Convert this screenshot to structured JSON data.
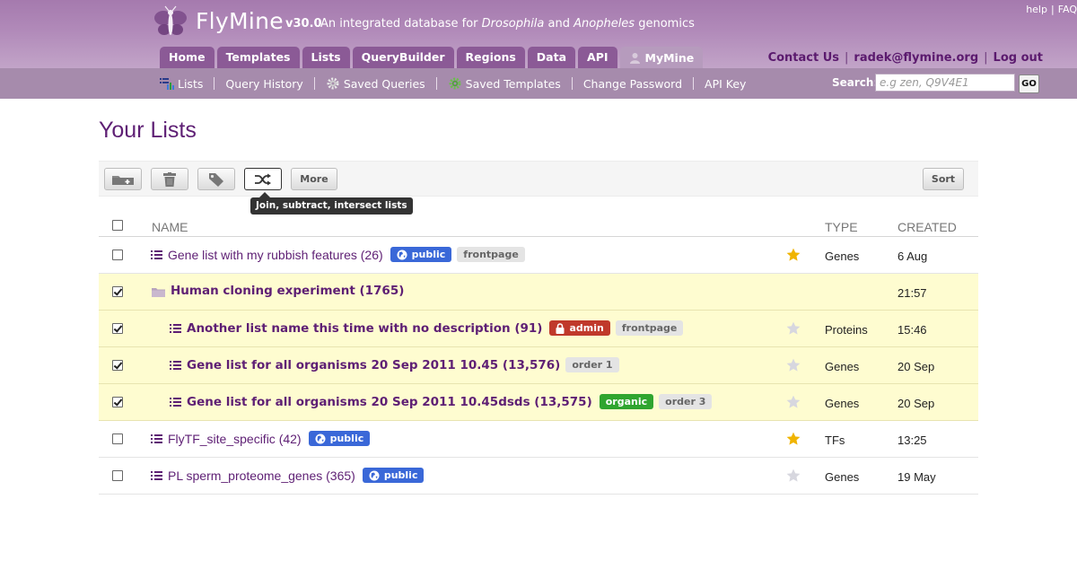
{
  "header": {
    "brand": "FlyMine",
    "version": "v30.0",
    "tagline_parts": [
      "An integrated database for ",
      "Drosophila",
      " and ",
      "Anopheles",
      " genomics"
    ],
    "top_links": [
      "help",
      "FAQ"
    ]
  },
  "tabs": [
    "Home",
    "Templates",
    "Lists",
    "QueryBuilder",
    "Regions",
    "Data",
    "API",
    "MyMine"
  ],
  "active_tab": "MyMine",
  "user_links": {
    "contact": "Contact Us",
    "email": "radek@flymine.org",
    "logout": "Log out"
  },
  "subnav": [
    "Lists",
    "Query History",
    "Saved Queries",
    "Saved Templates",
    "Change Password",
    "API Key"
  ],
  "search": {
    "label": "Search:",
    "placeholder": "e.g zen, Q9V4E1",
    "button": "GO"
  },
  "page_title": "Your Lists",
  "toolbar": {
    "more_label": "More",
    "sort_label": "Sort",
    "tooltip": "Join, subtract, intersect lists",
    "icons": [
      "add-folder-icon",
      "trash-icon",
      "tag-icon",
      "shuffle-icon"
    ]
  },
  "table": {
    "headers": {
      "name": "NAME",
      "type": "TYPE",
      "created": "CREATED"
    },
    "rows": [
      {
        "name": "Gene list with my rubbish features (26)",
        "indent": false,
        "folder": false,
        "checked": false,
        "starred": true,
        "type": "Genes",
        "created": "6 Aug",
        "badges": [
          {
            "kind": "public",
            "text": "public"
          },
          {
            "kind": "tag",
            "text": "frontpage"
          }
        ]
      },
      {
        "name": "Human cloning experiment (1765)",
        "indent": false,
        "folder": true,
        "checked": true,
        "starred": null,
        "type": "",
        "created": "21:57",
        "badges": []
      },
      {
        "name": "Another list name this time with no description (91)",
        "indent": true,
        "folder": false,
        "checked": true,
        "starred": false,
        "type": "Proteins",
        "created": "15:46",
        "badges": [
          {
            "kind": "admin",
            "text": "admin"
          },
          {
            "kind": "tag",
            "text": "frontpage"
          }
        ]
      },
      {
        "name": "Gene list for all organisms 20 Sep 2011 10.45 (13,576)",
        "indent": true,
        "folder": false,
        "checked": true,
        "starred": false,
        "type": "Genes",
        "created": "20 Sep",
        "badges": [
          {
            "kind": "tag",
            "text": "order 1"
          }
        ]
      },
      {
        "name": "Gene list for all organisms 20 Sep 2011 10.45dsds (13,575)",
        "indent": true,
        "folder": false,
        "checked": true,
        "starred": false,
        "type": "Genes",
        "created": "20 Sep",
        "badges": [
          {
            "kind": "organic",
            "text": "organic"
          },
          {
            "kind": "tag",
            "text": "order 3"
          }
        ]
      },
      {
        "name": "FlyTF_site_specific (42)",
        "indent": false,
        "folder": false,
        "checked": false,
        "starred": true,
        "type": "TFs",
        "created": "13:25",
        "badges": [
          {
            "kind": "public",
            "text": "public"
          }
        ]
      },
      {
        "name": "PL sperm_proteome_genes (365)",
        "indent": false,
        "folder": false,
        "checked": false,
        "starred": false,
        "type": "Genes",
        "created": "19 May",
        "badges": [
          {
            "kind": "public",
            "text": "public"
          }
        ]
      }
    ]
  },
  "colors": {
    "brand_purple": "#5e1f74",
    "header": "#b18ab9",
    "tab": "#8b5a96",
    "selected_row": "#fefcd0",
    "public_badge": "#3a68d8",
    "admin_badge": "#c0392b",
    "organic_badge": "#2fa52f",
    "star_on": "#f0b400",
    "star_off": "#d7d7df"
  }
}
